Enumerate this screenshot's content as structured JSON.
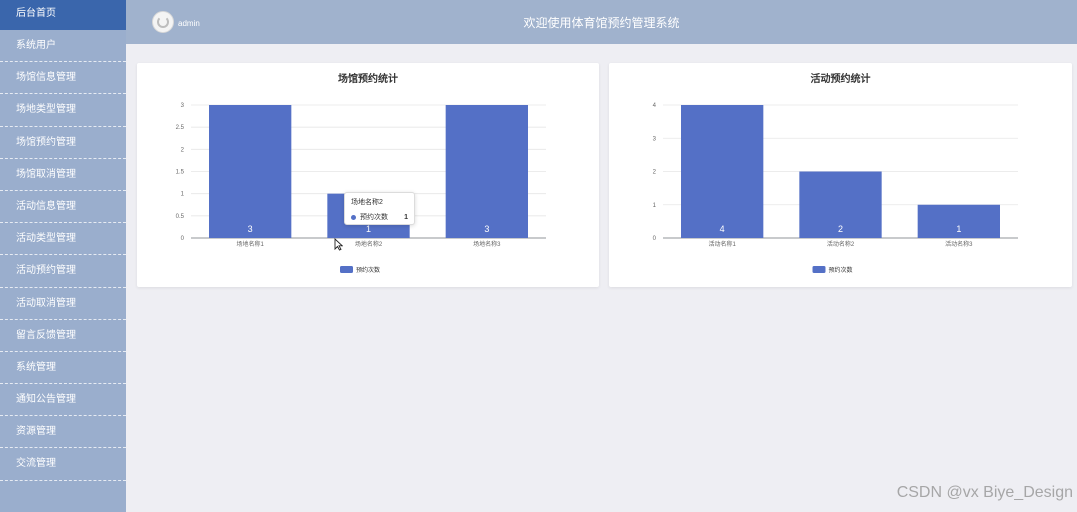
{
  "sidebar": {
    "items": [
      {
        "label": "后台首页",
        "active": true
      },
      {
        "label": "系统用户"
      },
      {
        "label": "场馆信息管理"
      },
      {
        "label": "场地类型管理"
      },
      {
        "label": "场馆预约管理"
      },
      {
        "label": "场馆取消管理"
      },
      {
        "label": "活动信息管理"
      },
      {
        "label": "活动类型管理"
      },
      {
        "label": "活动预约管理"
      },
      {
        "label": "活动取消管理"
      },
      {
        "label": "留言反馈管理"
      },
      {
        "label": "系统管理"
      },
      {
        "label": "通知公告管理"
      },
      {
        "label": "资源管理"
      },
      {
        "label": "交流管理"
      }
    ]
  },
  "header": {
    "username": "admin",
    "title": "欢迎使用体育馆预约管理系统"
  },
  "colors": {
    "bar": "#5470c6",
    "sidebar_active": "#3a66ac"
  },
  "chart_data": [
    {
      "type": "bar",
      "title": "场馆预约统计",
      "categories": [
        "场地名称1",
        "场地名称2",
        "场地名称3"
      ],
      "series": [
        {
          "name": "预约次数",
          "values": [
            3,
            1,
            3
          ]
        }
      ],
      "yticks": [
        "0",
        "0.5",
        "1",
        "1.5",
        "2",
        "2.5",
        "3"
      ],
      "ylim": [
        0,
        3
      ],
      "grid": true,
      "legend": "bottom"
    },
    {
      "type": "bar",
      "title": "活动预约统计",
      "categories": [
        "活动名称1",
        "活动名称2",
        "活动名称3"
      ],
      "series": [
        {
          "name": "预约次数",
          "values": [
            4,
            2,
            1
          ]
        }
      ],
      "yticks": [
        "0",
        "1",
        "2",
        "3",
        "4"
      ],
      "ylim": [
        0,
        4
      ],
      "grid": true,
      "legend": "bottom"
    }
  ],
  "tooltip": {
    "title": "场地名称2",
    "series": "预约次数",
    "value": "1"
  },
  "watermark": "CSDN @vx Biye_Design"
}
